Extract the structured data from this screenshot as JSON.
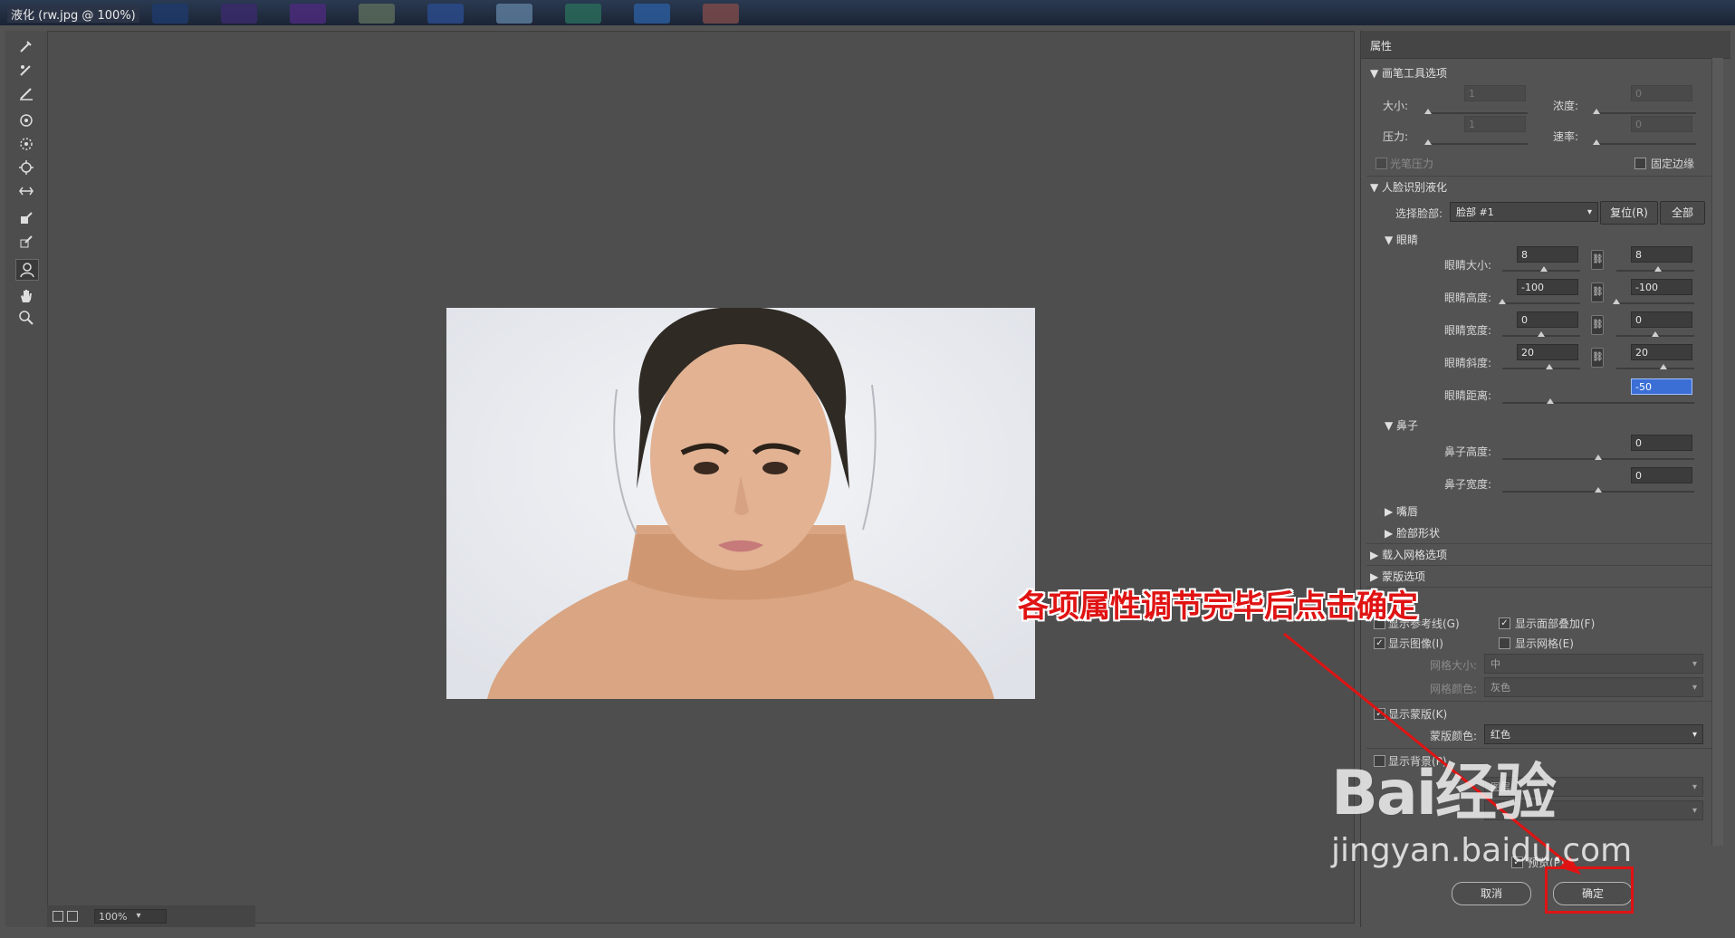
{
  "window": {
    "title": "液化 (rw.jpg @ 100%)"
  },
  "statusbar": {
    "zoom": "100%"
  },
  "panel": {
    "title": "属性",
    "brush_options": {
      "header": "画笔工具选项",
      "size_label": "大小:",
      "size_value": "1",
      "density_label": "浓度:",
      "density_value": "0",
      "pressure_label": "压力:",
      "pressure_value": "1",
      "rate_label": "速率:",
      "rate_value": "0",
      "stylus_label": "光笔压力",
      "pin_edges_label": "固定边缘"
    },
    "face_aware": {
      "header": "人脸识别液化",
      "select_face_label": "选择脸部:",
      "select_face_value": "脸部 #1",
      "reset_button": "复位(R)",
      "all_button": "全部",
      "eyes": {
        "header": "眼睛",
        "rows": [
          {
            "label": "眼睛大小:",
            "left": "8",
            "right": "8",
            "left_pos": 0.54,
            "right_pos": 0.54
          },
          {
            "label": "眼睛高度:",
            "left": "-100",
            "right": "-100",
            "left_pos": 0.0,
            "right_pos": 0.0
          },
          {
            "label": "眼睛宽度:",
            "left": "0",
            "right": "0",
            "left_pos": 0.5,
            "right_pos": 0.5
          },
          {
            "label": "眼睛斜度:",
            "left": "20",
            "right": "20",
            "left_pos": 0.6,
            "right_pos": 0.6
          }
        ],
        "distance_label": "眼睛距离:",
        "distance_value": "-50",
        "distance_pos": 0.25
      },
      "nose": {
        "header": "鼻子",
        "height_label": "鼻子高度:",
        "height_value": "0",
        "height_pos": 0.5,
        "width_label": "鼻子宽度:",
        "width_value": "0",
        "width_pos": 0.5
      },
      "mouth_header": "嘴唇",
      "face_shape_header": "脸部形状"
    },
    "load_mesh_header": "载入网格选项",
    "mask_options_header": "蒙版选项",
    "view": {
      "show_guides": "显示参考线(G)",
      "show_face_overlay": "显示面部叠加(F)",
      "show_image": "显示图像(I)",
      "show_mesh": "显示网格(E)",
      "mesh_size_label": "网格大小:",
      "mesh_size_value": "中",
      "mesh_color_label": "网格颜色:",
      "mesh_color_value": "灰色",
      "show_mask": "显示蒙版(K)",
      "mask_color_label": "蒙版颜色:",
      "mask_color_value": "红色",
      "show_backdrop": "显示背景(P)",
      "use_value": "图层"
    },
    "preview_label": "预览(P)",
    "cancel_button": "取消",
    "ok_button": "确定"
  },
  "annotation": {
    "text": "各项属性调节完毕后点击确定"
  },
  "watermark": {
    "brand": "Bai经验",
    "url": "jingyan.baidu.com"
  },
  "colors": {
    "annotation_red": "#e01313",
    "selection_blue": "#3b6fd6"
  }
}
